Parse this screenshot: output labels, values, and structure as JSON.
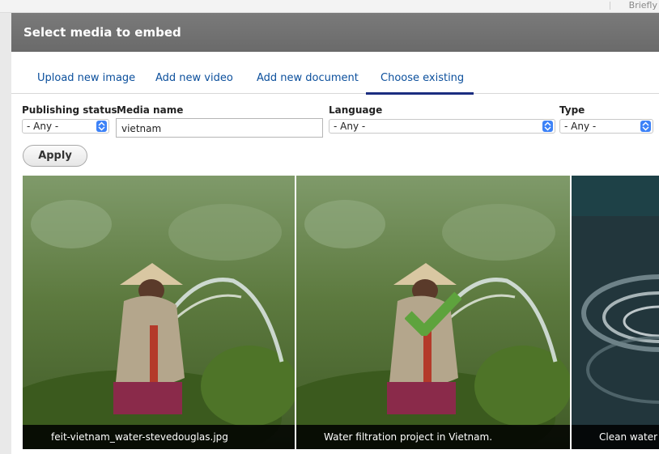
{
  "background": {
    "top_right_text": "Briefly"
  },
  "dialog": {
    "title": "Select media to embed"
  },
  "tabs": [
    {
      "label": "Upload new image"
    },
    {
      "label": "Add new video"
    },
    {
      "label": "Add new document"
    },
    {
      "label": "Choose existing"
    }
  ],
  "filters": {
    "publishing_status": {
      "label": "Publishing status",
      "value": "- Any -"
    },
    "media_name": {
      "label": "Media name",
      "value": "vietnam"
    },
    "language": {
      "label": "Language",
      "value": "- Any -"
    },
    "type": {
      "label": "Type",
      "value": "- Any -"
    },
    "apply_label": "Apply"
  },
  "media": [
    {
      "caption": "feit-vietnam_water-stevedouglas.jpg",
      "selected": false
    },
    {
      "caption": "Water filtration project in Vietnam.",
      "selected": true
    },
    {
      "caption": "Clean water",
      "selected": false
    }
  ],
  "colors": {
    "titlebar": "#6f6f6f",
    "tab_text": "#0b4f9c",
    "tab_underline": "#1b2d80",
    "select_accent": "#3d82f7",
    "selected_check": "#5ea33d"
  }
}
